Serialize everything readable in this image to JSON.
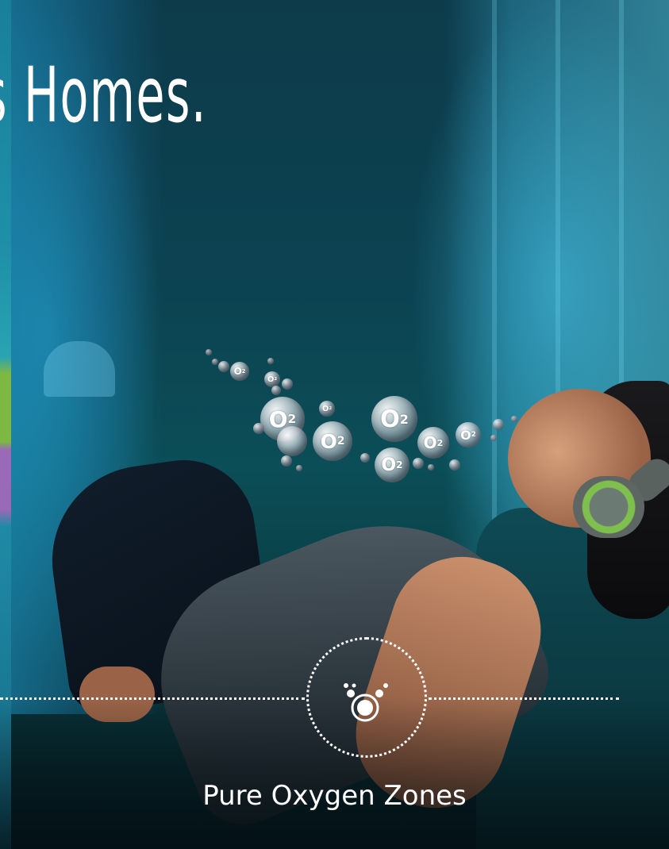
{
  "headline": "s Homes.",
  "badge": {
    "icon": "o2-molecule-icon",
    "label": "Pure Oxygen Zones"
  },
  "bubble_label": "O",
  "bubble_subscript": "2",
  "colors": {
    "accent_teal": "#0c4352",
    "text": "#ffffff",
    "headphone_green": "#7fbf4d"
  }
}
